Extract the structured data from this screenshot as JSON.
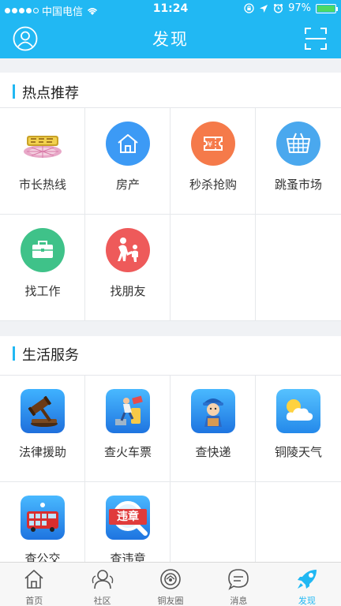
{
  "status_bar": {
    "carrier": "中国电信",
    "time": "11:24",
    "battery": "97%"
  },
  "nav": {
    "title": "发现"
  },
  "hot": {
    "title": "热点推荐",
    "items": [
      {
        "label": "市长热线",
        "icon": "mayor-hotline-logo"
      },
      {
        "label": "房产",
        "icon": "house-icon",
        "color": "#3c9af5"
      },
      {
        "label": "秒杀抢购",
        "icon": "coupon-ticket-icon",
        "color": "#f57a4a"
      },
      {
        "label": "跳蚤市场",
        "icon": "shopping-basket-icon",
        "color": "#4aa8ee"
      },
      {
        "label": "找工作",
        "icon": "briefcase-icon",
        "color": "#3fc289"
      },
      {
        "label": "找朋友",
        "icon": "friends-icon",
        "color": "#ee5a5a"
      }
    ]
  },
  "life": {
    "title": "生活服务",
    "items": [
      {
        "label": "法律援助",
        "icon": "gavel-icon"
      },
      {
        "label": "查火车票",
        "icon": "train-ticket-icon"
      },
      {
        "label": "查快递",
        "icon": "courier-icon"
      },
      {
        "label": "铜陵天气",
        "icon": "weather-icon"
      },
      {
        "label": "查公交",
        "icon": "bus-icon"
      },
      {
        "label": "查违章",
        "icon": "violation-icon",
        "badge": "违章"
      }
    ]
  },
  "tabs": [
    {
      "label": "首页",
      "icon": "home-icon"
    },
    {
      "label": "社区",
      "icon": "community-icon"
    },
    {
      "label": "铜友圈",
      "icon": "moments-icon"
    },
    {
      "label": "消息",
      "icon": "message-icon"
    },
    {
      "label": "发现",
      "icon": "rocket-icon",
      "active": true
    }
  ],
  "colors": {
    "brand": "#21b8f3"
  }
}
